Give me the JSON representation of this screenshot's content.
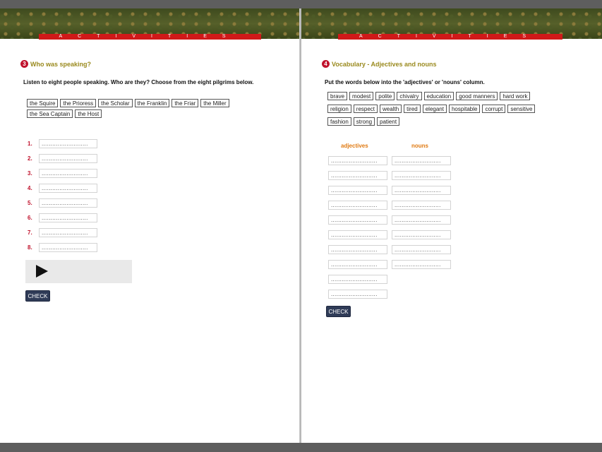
{
  "ribbon_text": "ACTIVITIES",
  "left": {
    "section_number": "3",
    "title": "Who was speaking?",
    "instruction": "Listen to eight people speaking. Who are they? Choose from the eight pilgrims below.",
    "pilgrims": [
      "the Squire",
      "the Prioress",
      "the Scholar",
      "the Franklin",
      "the Friar",
      "the Miller",
      "the Sea Captain",
      "the Host"
    ],
    "numbers": [
      "1.",
      "2.",
      "3.",
      "4.",
      "5.",
      "6.",
      "7.",
      "8."
    ],
    "blank": "..........................",
    "check_label": "CHECK"
  },
  "right": {
    "section_number": "4",
    "title": "Vocabulary - Adjectives and nouns",
    "instruction": "Put the words below into the 'adjectives' or 'nouns' column.",
    "words": [
      "brave",
      "modest",
      "polite",
      "chivalry",
      "education",
      "good manners",
      "hard work",
      "religion",
      "respect",
      "wealth",
      "tired",
      "elegant",
      "hospitable",
      "corrupt",
      "sensitive",
      "fashion",
      "strong",
      "patient"
    ],
    "col_adjectives": "adjectives",
    "col_nouns": "nouns",
    "adjective_blank_count": 10,
    "noun_blank_count": 8,
    "blank": "..........................",
    "check_label": "CHECK"
  },
  "colors": {
    "accent_red": "#c0122c",
    "title_olive": "#9a8a1e",
    "column_orange": "#e07a12",
    "button_navy": "#2f3b57"
  }
}
